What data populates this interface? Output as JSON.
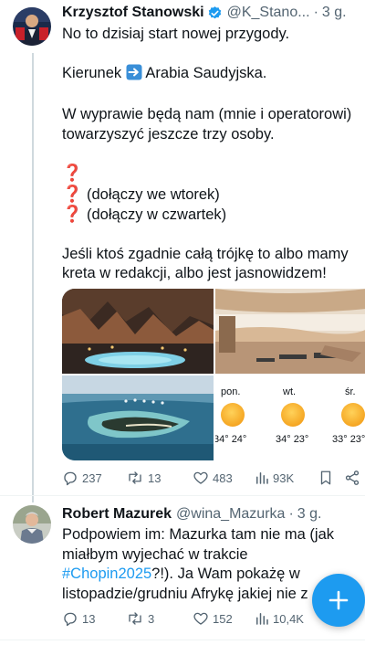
{
  "tweet1": {
    "name": "Krzysztof Stanowski",
    "handle": "@K_Stano...",
    "dot": "·",
    "time": "3 g.",
    "line1": "No to dzisiaj start nowej przygody.",
    "line2_before": "Kierunek ",
    "line2_after": " Arabia Saudyjska.",
    "line3": "W wyprawie będą nam (mnie i operatorowi) towarzyszyć jeszcze trzy osoby.",
    "q1": "❓",
    "q2": "❓",
    "q2_text": " (dołączy we wtorek)",
    "q3": "❓",
    "q3_text": " (dołączy w czwartek)",
    "line4": "Jeśli ktoś zgadnie całą trójkę to albo mamy kreta w redakcji, albo jest jasnowidzem!",
    "weather": {
      "days": [
        "pon.",
        "wt.",
        "śr."
      ],
      "temps": [
        "34° 24°",
        "34° 23°",
        "33° 23°"
      ]
    },
    "stats": {
      "replies": "237",
      "retweets": "13",
      "likes": "483",
      "views": "93K"
    }
  },
  "tweet2": {
    "name": "Robert Mazurek",
    "handle": "@wina_Mazurka",
    "dot": "·",
    "time": "3 g.",
    "text_before": "Podpowiem im: Mazurka tam nie ma (jak miałbym wyjechać w trakcie ",
    "hashtag": "#Chopin2025",
    "text_after": "?!). Ja Wam pokażę w listopadzie/grudniu Afrykę jakiej nie z",
    "stats": {
      "replies": "13",
      "retweets": "3",
      "likes": "152",
      "views": "10,4K"
    }
  },
  "colors": {
    "accent": "#1d9bf0",
    "secondary_text": "#536471",
    "question_mark": "#d4252a"
  },
  "icons": {
    "verified": "verified-badge-icon",
    "arrow": "right-arrow-emoji-icon",
    "reply": "reply-icon",
    "retweet": "retweet-icon",
    "like": "heart-icon",
    "views": "views-chart-icon",
    "bookmark": "bookmark-icon",
    "share": "share-icon",
    "compose": "plus-icon"
  }
}
